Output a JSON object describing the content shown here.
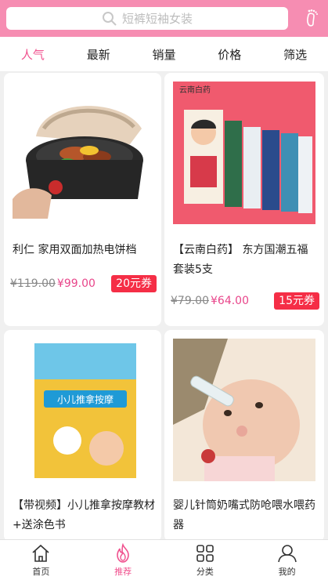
{
  "search": {
    "placeholder": "短裤短袖女装"
  },
  "tabs": [
    {
      "label": "人气",
      "active": true
    },
    {
      "label": "最新"
    },
    {
      "label": "销量"
    },
    {
      "label": "价格"
    },
    {
      "label": "筛选"
    }
  ],
  "products": [
    {
      "title": "利仁 家用双面加热电饼档",
      "old_price": "¥119.00",
      "price": "¥99.00",
      "coupon": "20元券",
      "image": "electric-baking-pan"
    },
    {
      "title": "【云南白药】 东方国潮五福套装5支",
      "old_price": "¥79.00",
      "price": "¥64.00",
      "coupon": "15元券",
      "image": "toothpaste-set",
      "image_brand_text": "云南白药"
    },
    {
      "title": "【带视频】小儿推拿按摩教材+送涂色书",
      "image": "book-cover",
      "image_text": "小儿推拿按摩"
    },
    {
      "title": "婴儿针筒奶嘴式防呛喂水喂药器",
      "image": "baby-feeding"
    }
  ],
  "bottom_nav": [
    {
      "label": "首页",
      "icon": "home-icon"
    },
    {
      "label": "推荐",
      "icon": "flame-icon",
      "active": true
    },
    {
      "label": "分类",
      "icon": "grid-icon"
    },
    {
      "label": "我的",
      "icon": "user-icon"
    }
  ],
  "colors": {
    "accent": "#f68db2",
    "active_text": "#f0518e",
    "price": "#e8458a",
    "coupon": "#f52e46"
  }
}
